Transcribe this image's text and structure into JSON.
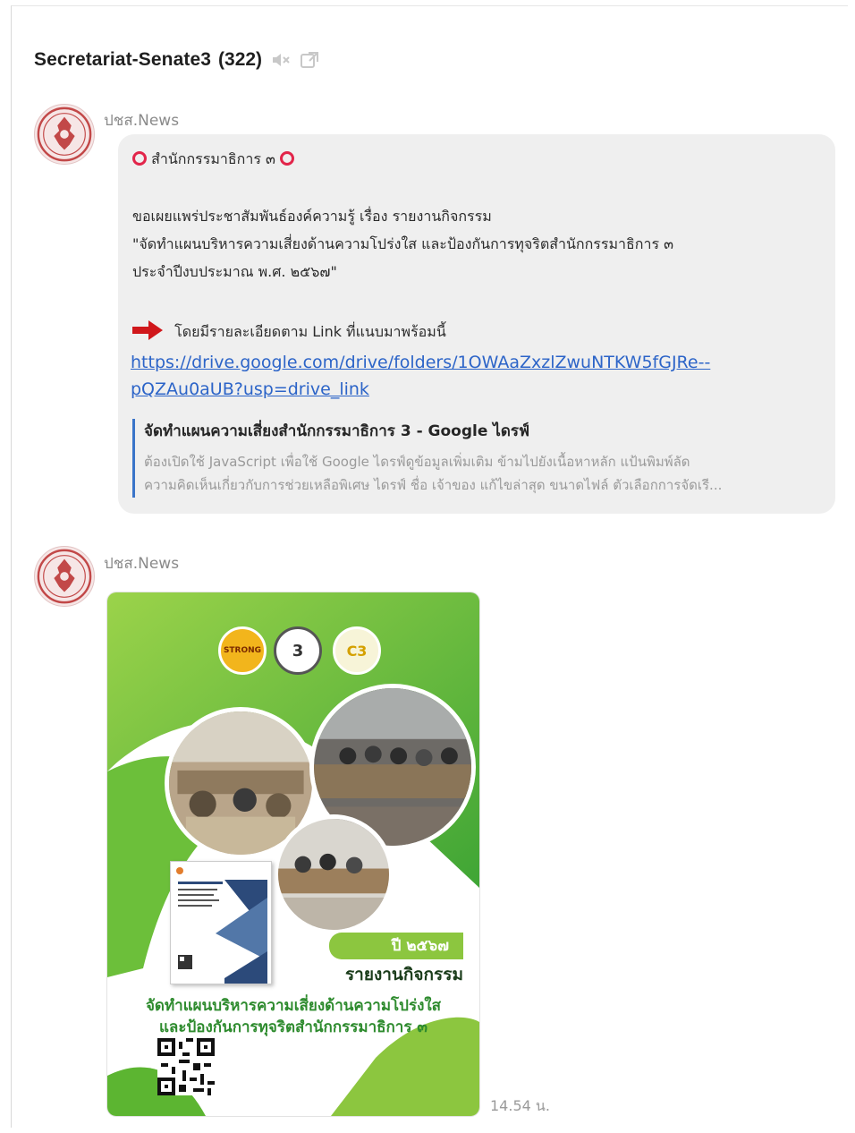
{
  "header": {
    "title": "Secretariat-Senate3",
    "member_count": "(322)",
    "icons": [
      "muted-speaker-icon",
      "external-link-icon"
    ]
  },
  "messages": [
    {
      "sender": "ปชส.News",
      "avatar": "senate-emblem",
      "heading": "สำนักกรรมาธิการ ๓",
      "body_lines": [
        "ขอเผยแพร่ประชาสัมพันธ์องค์ความรู้ เรื่อง รายงานกิจกรรม",
        "\"จัดทำแผนบริหารความเสี่ยงด้านความโปร่งใส และป้องกันการทุจริตสำนักกรรมาธิการ ๓",
        "ประจำปีงบประมาณ พ.ศ. ๒๕๖๗\""
      ],
      "link_intro": "โดยมีรายละเอียดตาม Link ที่แนบมาพร้อมนี้",
      "link_line1": "https://drive.google.com/drive/folders/1OWAaZxzlZwuNTKW5fGJRe--",
      "link_line2": "pQZAu0aUB?usp=drive_link",
      "preview": {
        "title": "จัดทำแผนความเสี่ยงสำนักกรรมาธิการ 3 - Google ไดรฟ์",
        "desc1": "ต้องเปิดใช้ JavaScript เพื่อใช้ Google ไดรฟ์ดูข้อมูลเพิ่มเติม ข้ามไปยังเนื้อหาหลัก แป้นพิมพ์ลัด",
        "desc2": "ความคิดเห็นเกี่ยวกับการช่วยเหลือพิเศษ ไดรฟ์ ชื่อ เจ้าของ แก้ไขล่าสุด ขนาดไฟล์ ตัวเลือกการจัดเรี..."
      }
    },
    {
      "sender": "ปชส.News",
      "avatar": "senate-emblem",
      "poster": {
        "year_tag": "ปี ๒๕๖๗",
        "label": "รายงานกิจกรรม",
        "subtitle1": "จัดทำแผนบริหารความเสี่ยงด้านความโปร่งใส",
        "subtitle2": "และป้องกันการทุจริตสำนักกรรมาธิการ ๓",
        "badges": [
          "STRONG",
          "3",
          "C3"
        ]
      },
      "timestamp": "14.54 น."
    }
  ],
  "colors": {
    "link": "#2c64c8",
    "bubble": "#efefef",
    "ring": "#e2254a",
    "poster_green": "#8cc63f"
  }
}
